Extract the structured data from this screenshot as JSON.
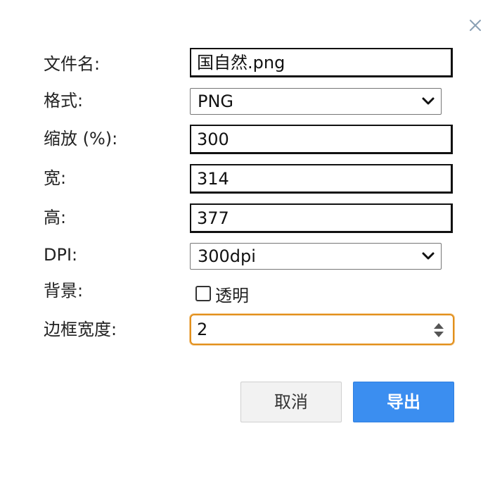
{
  "dialog": {
    "close_icon": "close-icon",
    "fields": {
      "filename": {
        "label": "文件名:",
        "value": "国自然.png"
      },
      "format": {
        "label": "格式:",
        "value": "PNG"
      },
      "scale": {
        "label": "缩放 (%):",
        "value": "300"
      },
      "width": {
        "label": "宽:",
        "value": "314"
      },
      "height": {
        "label": "高:",
        "value": "377"
      },
      "dpi": {
        "label": "DPI:",
        "value": "300dpi"
      },
      "background": {
        "label": "背景:",
        "checkbox_label": "透明",
        "checked": false
      },
      "border_width": {
        "label": "边框宽度:",
        "value": "2"
      }
    },
    "buttons": {
      "cancel": "取消",
      "export": "导出"
    },
    "colors": {
      "primary_button": "#3b8ef0",
      "focus_border": "#e2901c"
    }
  }
}
